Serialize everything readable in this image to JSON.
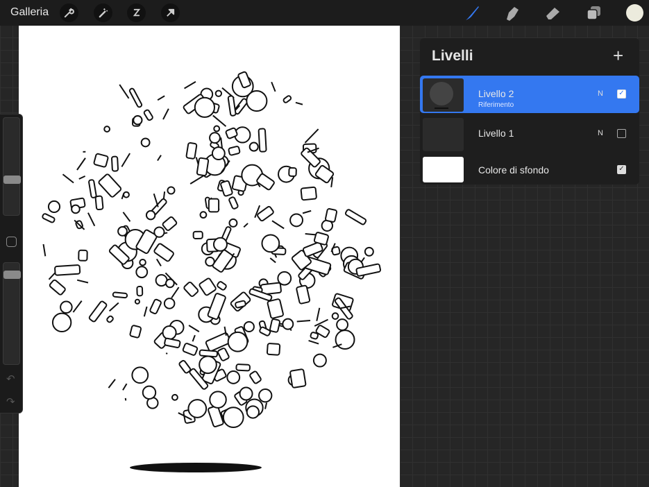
{
  "topbar": {
    "gallery_label": "Galleria",
    "left_tools": [
      "wrench-icon",
      "magic-wand-icon",
      "selection-icon",
      "move-arrow-icon"
    ],
    "right_tools": [
      "brush-icon",
      "smudge-icon",
      "eraser-icon",
      "layers-icon"
    ],
    "current_color": "#ecebdd",
    "accent": "#3478f0"
  },
  "sidebar": {
    "brush_size": 0.36,
    "opacity": 0.92
  },
  "layers": {
    "title": "Livelli",
    "add_label": "+",
    "items": [
      {
        "name": "Livello 2",
        "subtitle": "Riferimento",
        "blend": "N",
        "visible": true,
        "selected": true
      },
      {
        "name": "Livello 1",
        "blend": "N",
        "visible": false,
        "selected": false
      },
      {
        "name": "Colore di sfondo",
        "visible": true,
        "selected": false
      }
    ]
  }
}
